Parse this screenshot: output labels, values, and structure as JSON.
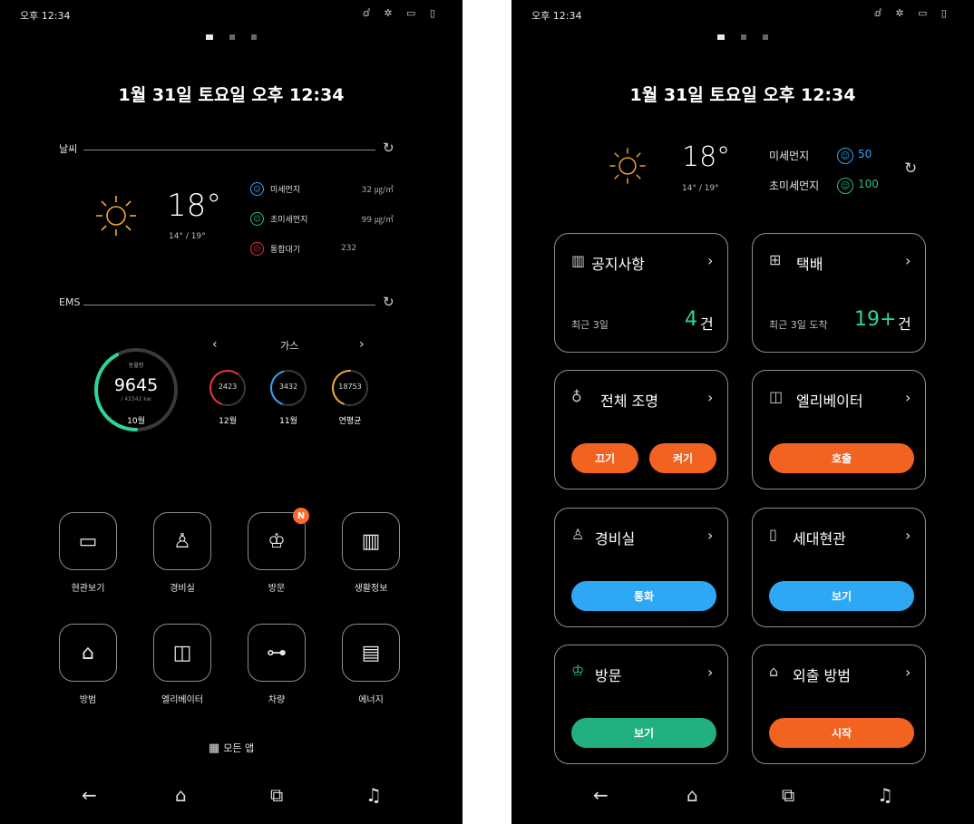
{
  "status_bar": {
    "time": "오후 12:34",
    "icons": "ⅆ ✲ ▭ ▯"
  },
  "date_title": "1월 31일 토요일  오후 12:34",
  "left": {
    "weather_label": "날씨",
    "temperature": "18°",
    "temp_range": "14° / 19°",
    "air": [
      {
        "name": "미세먼지",
        "value": "32 ㎍/㎥",
        "color": "#2ea7f5"
      },
      {
        "name": "초미세먼지",
        "value": "99 ㎍/㎥",
        "color": "#22c07f"
      },
      {
        "name": "통합대기",
        "value": "232",
        "color": "#e8313a"
      }
    ],
    "ems_label": "EMS",
    "ems_type": "가스",
    "main_gauge": {
      "title": "동월령",
      "value": "9645",
      "sub": "/ 42342 kw",
      "month": "10월",
      "fraction": 0.42,
      "color": "#2dd4a0"
    },
    "small_gauges": [
      {
        "value": "2423",
        "label": "12월",
        "color": "#e8313a",
        "fraction": 0.55
      },
      {
        "value": "3432",
        "label": "11월",
        "color": "#2ea7f5",
        "fraction": 0.4
      },
      {
        "value": "18753",
        "label": "연평균",
        "color": "#f0a830",
        "fraction": 0.45
      }
    ],
    "apps": [
      {
        "label": "현관보기",
        "icon": "door-icon"
      },
      {
        "label": "경비실",
        "icon": "guard-icon"
      },
      {
        "label": "방문",
        "icon": "visitor-icon",
        "badge": "N"
      },
      {
        "label": "생활정보",
        "icon": "building-icon"
      },
      {
        "label": "방범",
        "icon": "home-lock-icon"
      },
      {
        "label": "엘리베이터",
        "icon": "elevator-icon"
      },
      {
        "label": "차량",
        "icon": "car-icon"
      },
      {
        "label": "에너지",
        "icon": "energy-chart-icon"
      }
    ],
    "all_apps": "모든 앱"
  },
  "right": {
    "temperature": "18°",
    "temp_range": "14° / 19°",
    "fine_dust_label": "미세먼지",
    "fine_dust_value": "50",
    "ultra_dust_label": "초미세먼지",
    "ultra_dust_value": "100",
    "cards": {
      "notice": {
        "title": "공지사항",
        "sub": "최근 3일",
        "count": "4",
        "unit": "건"
      },
      "parcel": {
        "title": "택배",
        "sub": "최근 3일 도착",
        "count": "19+",
        "unit": "건"
      },
      "light": {
        "title": "전체 조명",
        "off": "끄기",
        "on": "켜기"
      },
      "elevator": {
        "title": "엘리베이터",
        "call": "호출"
      },
      "guard": {
        "title": "경비실",
        "call": "통화"
      },
      "entrance": {
        "title": "세대현관",
        "view": "보기"
      },
      "visit": {
        "title": "방문",
        "view": "보기"
      },
      "outing": {
        "title": "외출 방범",
        "start": "시작"
      }
    }
  }
}
